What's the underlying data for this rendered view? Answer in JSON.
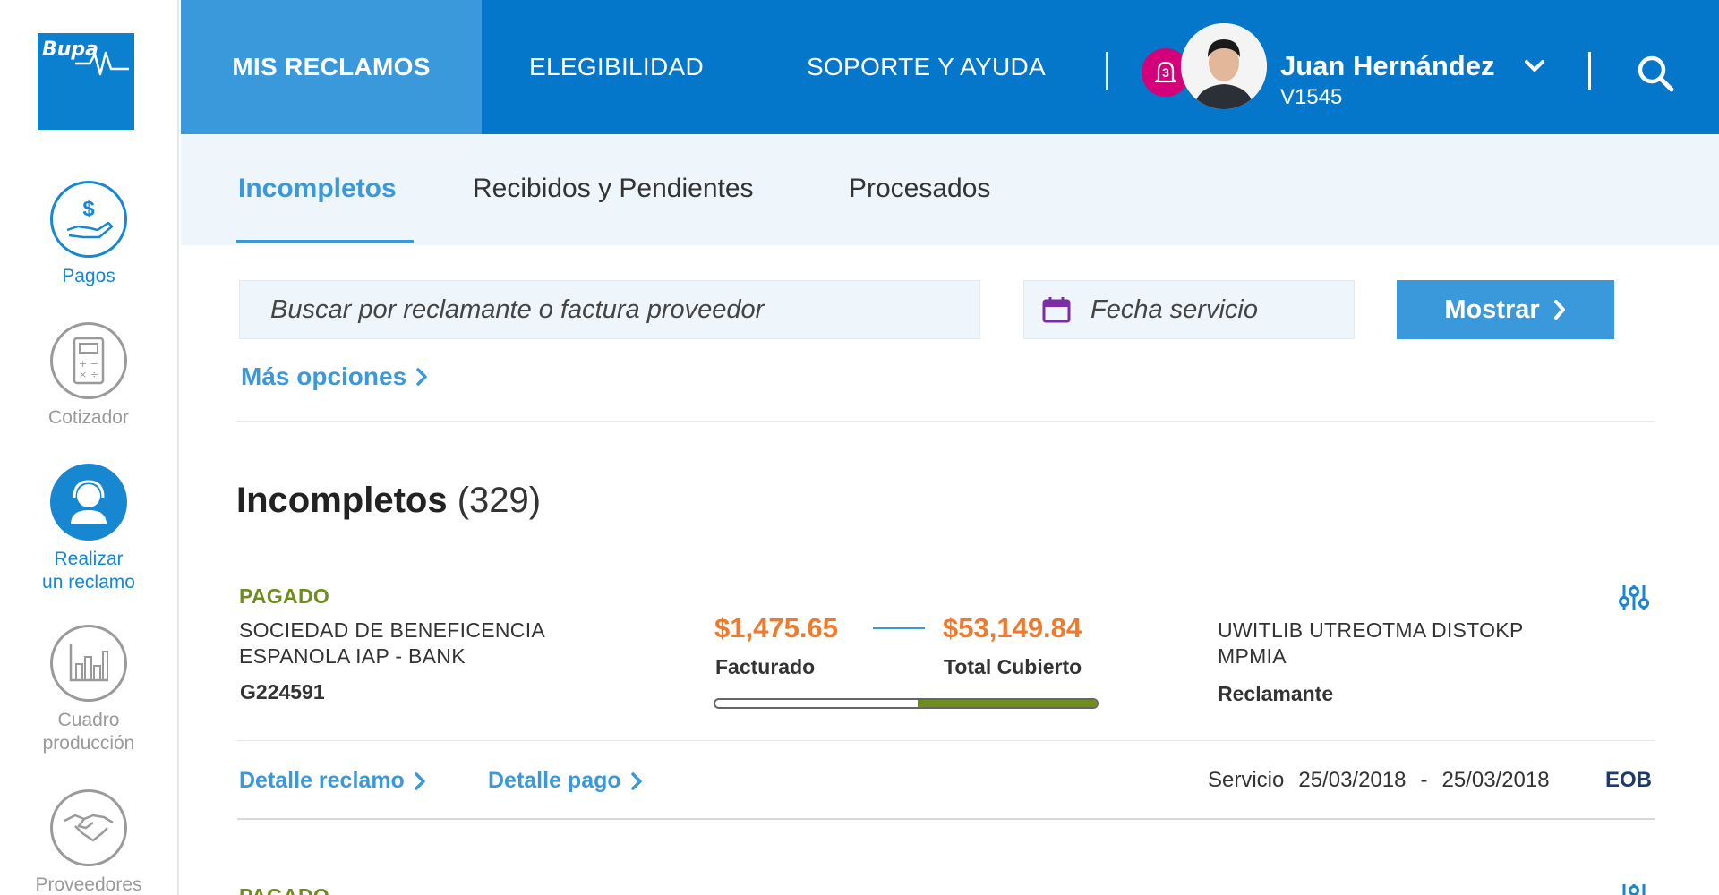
{
  "sidebar": {
    "logo_text": "Bupa",
    "items": [
      {
        "label": "Pagos",
        "icon": "hand-dollar-icon"
      },
      {
        "label": "Cotizador",
        "icon": "calculator-icon"
      },
      {
        "label_line1": "Realizar",
        "label_line2": "un reclamo",
        "icon": "support-agent-icon"
      },
      {
        "label_line1": "Cuadro",
        "label_line2": "producción",
        "icon": "bar-chart-icon"
      },
      {
        "label": "Proveedores",
        "icon": "handshake-icon"
      }
    ]
  },
  "topnav": {
    "items": [
      "MIS RECLAMOS",
      "ELEGIBILIDAD",
      "SOPORTE Y AYUDA"
    ],
    "notification_count": "3",
    "user_name": "Juan Hernández",
    "user_id": "V1545"
  },
  "tabs": [
    "Incompletos",
    "Recibidos y Pendientes",
    "Procesados"
  ],
  "filters": {
    "search_placeholder": "Buscar por reclamante o factura proveedor",
    "date_placeholder": "Fecha servicio",
    "submit_label": "Mostrar",
    "more_options": "Más opciones"
  },
  "section": {
    "title": "Incompletos",
    "count": "(329)"
  },
  "claims": [
    {
      "status": "PAGADO",
      "provider_line1": "SOCIEDAD DE BENEFICENCIA",
      "provider_line2": "ESPANOLA IAP - BANK",
      "invoice": "G224591",
      "billed": "$1,475.65",
      "billed_label": "Facturado",
      "covered": "$53,149.84",
      "covered_label": "Total Cubierto",
      "covered_fraction": 0.47,
      "claimant_line1": "UWITLIB UTREOTMA DISTOKP",
      "claimant_line2": "MPMIA",
      "claimant_label": "Reclamante",
      "detail_claim": "Detalle reclamo",
      "detail_payment": "Detalle pago",
      "service_label": "Servicio",
      "service_from": "25/03/2018",
      "service_sep": "-",
      "service_to": "25/03/2018",
      "eob": "EOB"
    },
    {
      "status": "PAGADO"
    }
  ],
  "colors": {
    "primary": "#0577cb",
    "primary_light": "#3a99db",
    "paid_green": "#6e8d1a",
    "amount_orange": "#f07a2c",
    "notification": "#d3007a"
  }
}
